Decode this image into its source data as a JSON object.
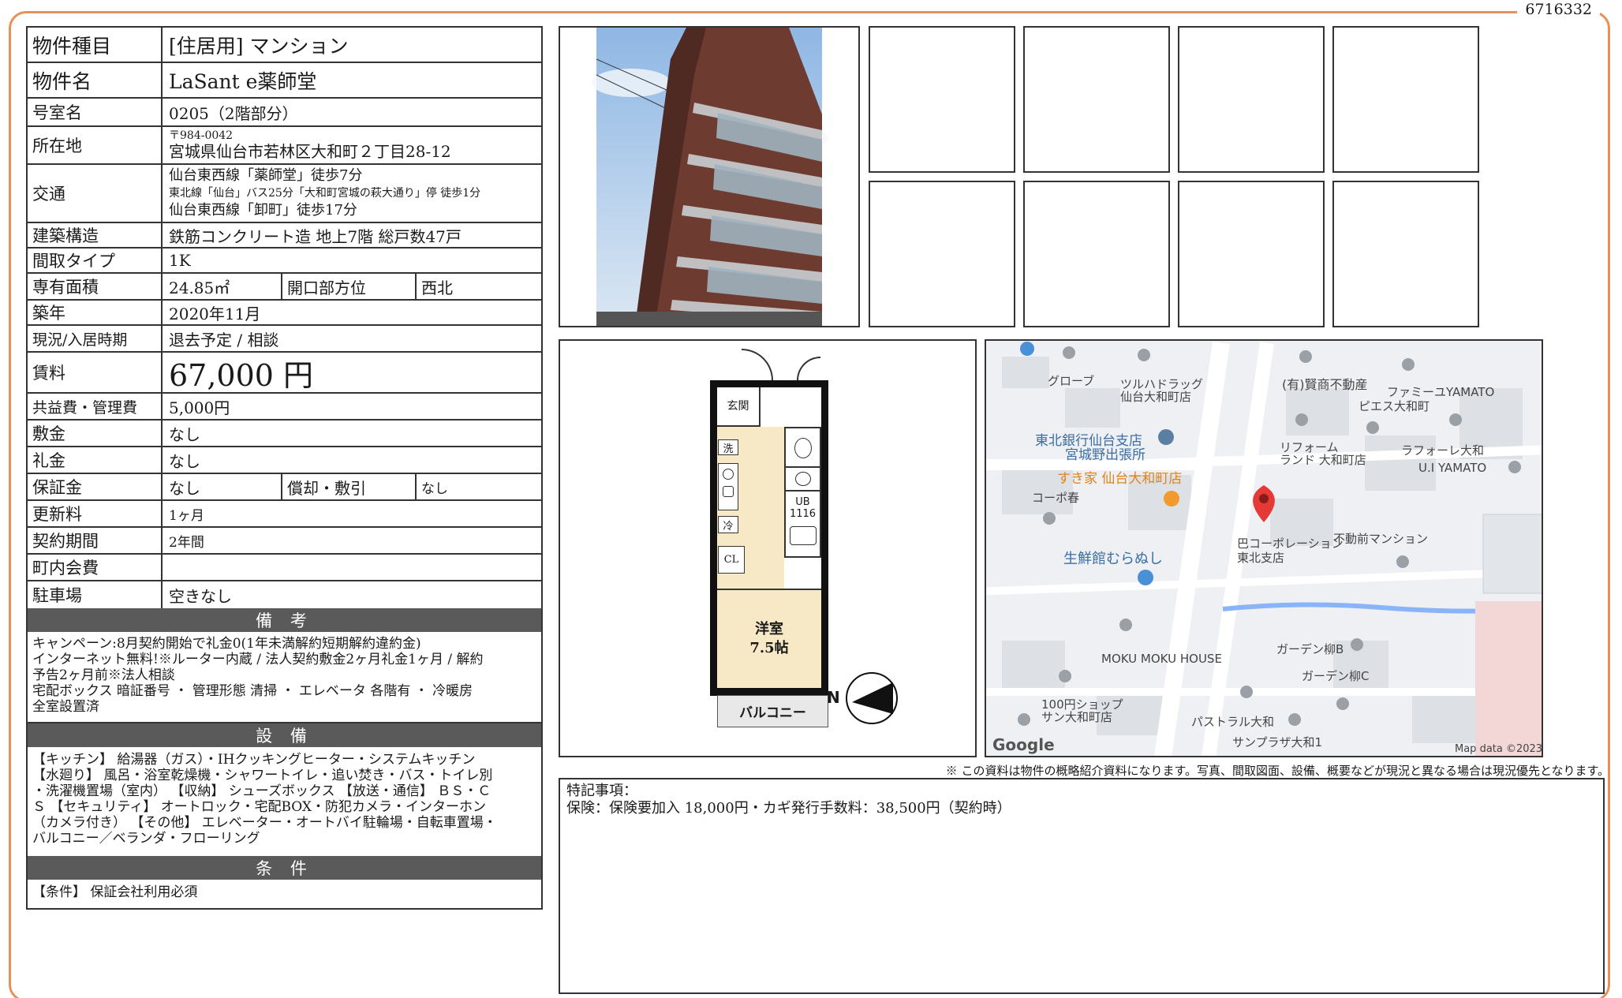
{
  "doc_id": "6716332",
  "property": {
    "type_label": "物件種目",
    "type_value": "[住居用] マンション",
    "name_label": "物件名",
    "name_value": "LaSant e薬師堂",
    "room_label": "号室名",
    "room_value": "0205（2階部分）",
    "address_label": "所在地",
    "postal": "〒984-0042",
    "address": "宮城県仙台市若林区大和町２丁目28-12",
    "transport_label": "交通",
    "transport_1": "仙台東西線「薬師堂」徒歩7分",
    "transport_2": "東北線「仙台」バス25分「大和町宮城の萩大通り」停 徒歩1分",
    "transport_3": "仙台東西線「卸町」徒歩17分",
    "structure_label": "建築構造",
    "structure_value": "鉄筋コンクリート造 地上7階 総戸数47戸",
    "layout_label": "間取タイプ",
    "layout_value": "1K",
    "area_label": "専有面積",
    "area_value": "24.85㎡",
    "direction_label": "開口部方位",
    "direction_value": "西北",
    "built_label": "築年",
    "built_value": "2020年11月",
    "status_label": "現況/入居時期",
    "status_value": "退去予定 / 相談",
    "rent_label": "賃料",
    "rent_value": "67,000 円",
    "fee_label": "共益費・管理費",
    "fee_value": "5,000円",
    "deposit_label": "敷金",
    "deposit_value": "なし",
    "key_money_label": "礼金",
    "key_money_value": "なし",
    "guarantee_label": "保証金",
    "guarantee_value": "なし",
    "amort_label": "償却・敷引",
    "amort_value": "なし",
    "renewal_label": "更新料",
    "renewal_value": "1ヶ月",
    "contract_label": "契約期間",
    "contract_value": "2年間",
    "community_label": "町内会費",
    "community_value": "",
    "parking_label": "駐車場",
    "parking_value": "空きなし"
  },
  "remarks": {
    "title": "備 考",
    "lines": [
      "キャンペーン:8月契約開始で礼金0(1年未満解約短期解約違約金)",
      "インターネット無料!※ルーター内蔵 / 法人契約敷金2ヶ月礼金1ヶ月 / 解約",
      "予告2ヶ月前※法人相談",
      "宅配ボックス 暗証番号 ・ 管理形態 清掃 ・ エレベータ 各階有 ・ 冷暖房",
      "全室設置済"
    ]
  },
  "facilities": {
    "title": "設 備",
    "lines": [
      "【キッチン】 給湯器（ガス）・IHクッキングヒーター・システムキッチン",
      "【水廻り】 風呂・浴室乾燥機・シャワートイレ・追い焚き・バス・トイレ別",
      "・洗濯機置場（室内） 【収納】 シューズボックス 【放送・通信】 ＢＳ・Ｃ",
      "Ｓ 【セキュリティ】 オートロック・宅配BOX・防犯カメラ・インターホン",
      "（カメラ付き） 【その他】 エレベーター・オートバイ駐輪場・自転車置場・",
      "バルコニー／ベランダ・フローリング"
    ]
  },
  "conditions": {
    "title": "条 件",
    "text": "【条件】 保証会社利用必須"
  },
  "floorplan": {
    "entrance": "玄関",
    "wash": "洗",
    "fridge": "冷",
    "closet": "CL",
    "ub_label": "UB",
    "ub_size": "1116",
    "room_name": "洋室",
    "room_size": "7.5帖",
    "balcony": "バルコニー",
    "north": "N"
  },
  "map": {
    "labels": [
      "グローブ",
      "ツルハドラッグ",
      "仙台大和町店",
      "(有)賢商不動産",
      "ファミーユYAMATO",
      "ピエス大和町",
      "東北銀行仙台支店",
      "宮城野出張所",
      "リフォーム",
      "ランド 大和町店",
      "ラフォーレ大和",
      "U.I YAMATO",
      "すき家 仙台大和町店",
      "コーポ春",
      "不動前マンション",
      "巴コーポレーション",
      "東北支店",
      "生鮮館むらぬし",
      "MOKU MOKU HOUSE",
      "ガーデン柳B",
      "ガーデン柳C",
      "100円ショップ",
      "サン大和町店",
      "パストラル大和",
      "サンプラザ大和1"
    ],
    "google": "Google",
    "attribution": "Map data ©2023"
  },
  "disclaimer": "※ この資料は物件の概略紹介資料になります。写真、間取図面、設備、概要などが現況と異なる場合は現況優先となります。",
  "special": {
    "title": "特記事項：",
    "text": "保険：保険要加入 18,000円・カギ発行手数料：38,500円（契約時）"
  },
  "colors": {
    "frame": "#e8905a",
    "band": "#5a5a5a",
    "building": "#6e3b30",
    "pin": "#e53935"
  }
}
